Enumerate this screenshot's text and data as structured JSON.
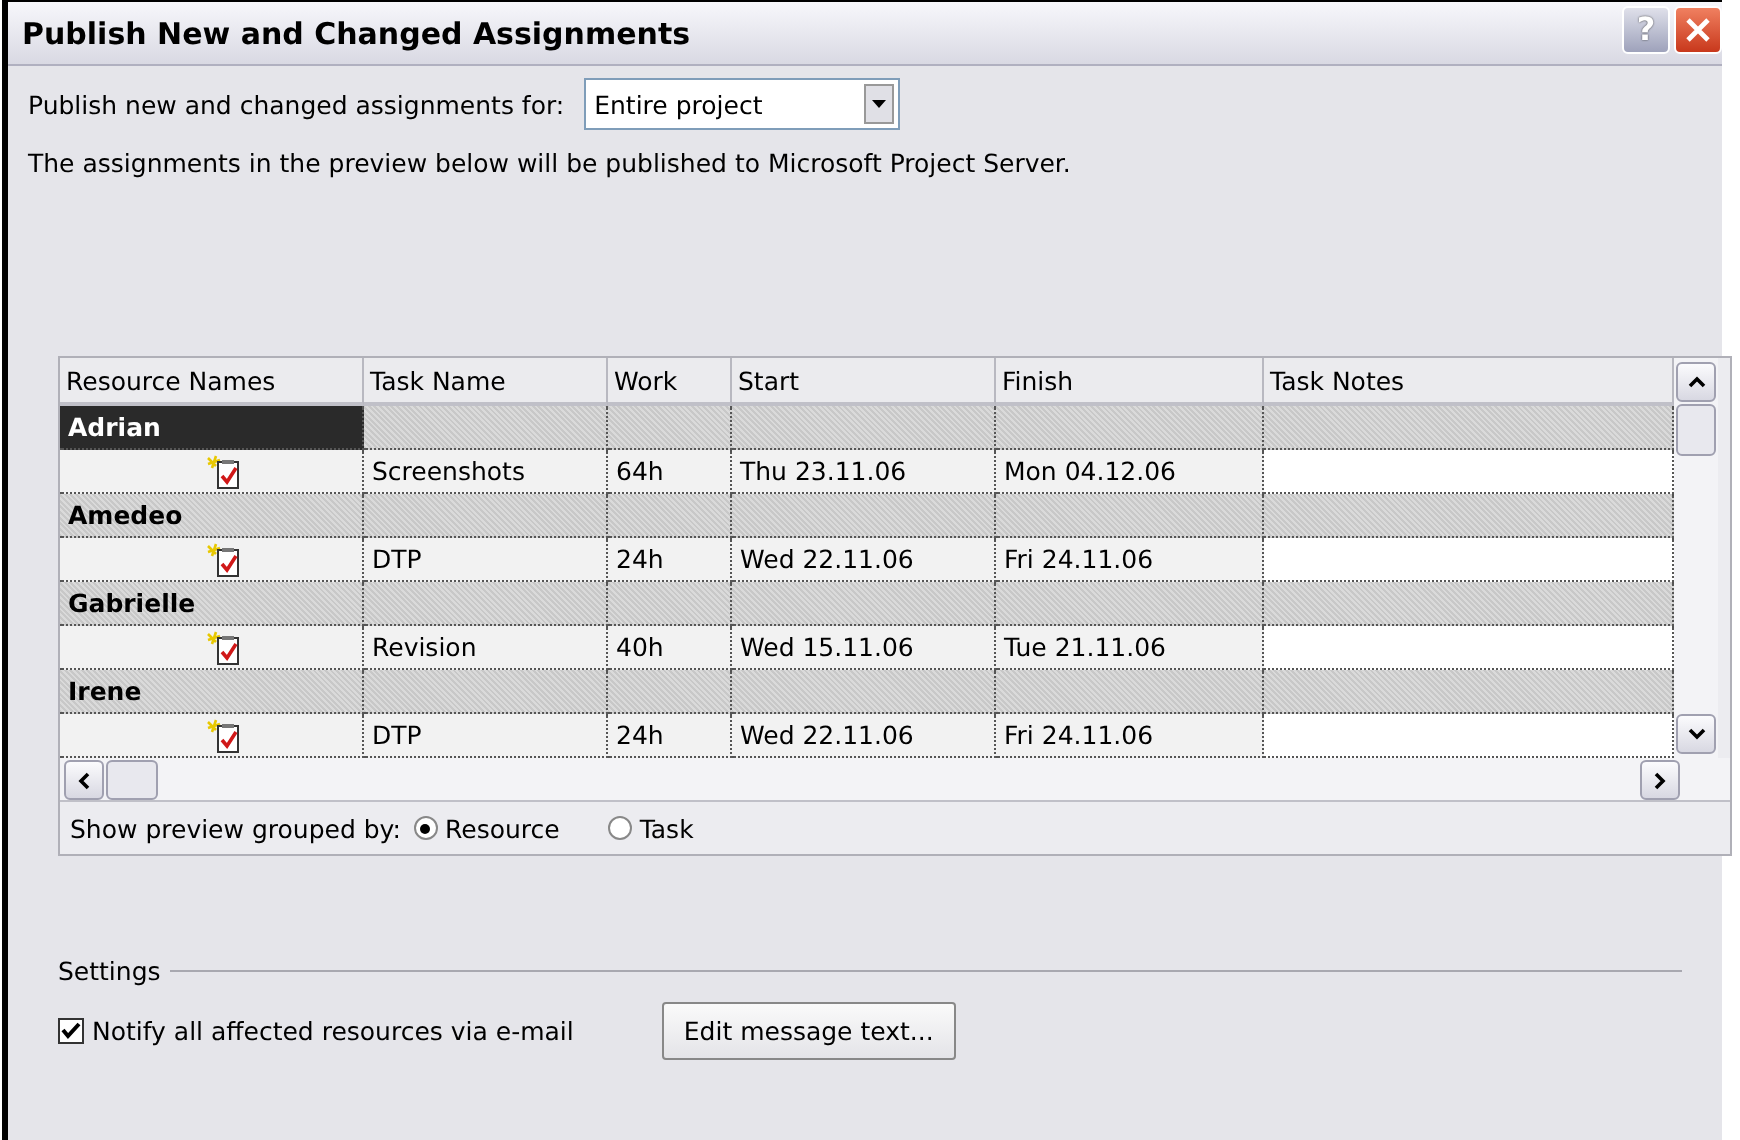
{
  "window": {
    "title": "Publish New and Changed Assignments",
    "help": "?"
  },
  "publish_for": {
    "label": "Publish new and changed assignments for:",
    "value": "Entire project"
  },
  "info": "The assignments in the preview below will be published to Microsoft Project Server.",
  "table": {
    "columns": [
      "Resource Names",
      "Task Name",
      "Work",
      "Start",
      "Finish",
      "Task Notes"
    ],
    "rows": [
      {
        "kind": "group",
        "name": "Adrian",
        "selected": true
      },
      {
        "kind": "assignment",
        "task": "Screenshots",
        "work": "64h",
        "start": "Thu 23.11.06",
        "finish": "Mon 04.12.06"
      },
      {
        "kind": "group",
        "name": "Amedeo",
        "selected": false
      },
      {
        "kind": "assignment",
        "task": "DTP",
        "work": "24h",
        "start": "Wed 22.11.06",
        "finish": "Fri 24.11.06"
      },
      {
        "kind": "group",
        "name": "Gabrielle",
        "selected": false
      },
      {
        "kind": "assignment",
        "task": "Revision",
        "work": "40h",
        "start": "Wed 15.11.06",
        "finish": "Tue 21.11.06"
      },
      {
        "kind": "group",
        "name": "Irene",
        "selected": false
      },
      {
        "kind": "assignment",
        "task": "DTP",
        "work": "24h",
        "start": "Wed 22.11.06",
        "finish": "Fri 24.11.06"
      }
    ]
  },
  "group_by": {
    "label": "Show preview grouped by:",
    "options": [
      {
        "label": "Resource",
        "selected": true
      },
      {
        "label": "Task",
        "selected": false
      }
    ]
  },
  "settings": {
    "title": "Settings",
    "notify": {
      "label": "Notify all affected resources via e-mail",
      "checked": true
    },
    "edit_button": "Edit message text..."
  }
}
